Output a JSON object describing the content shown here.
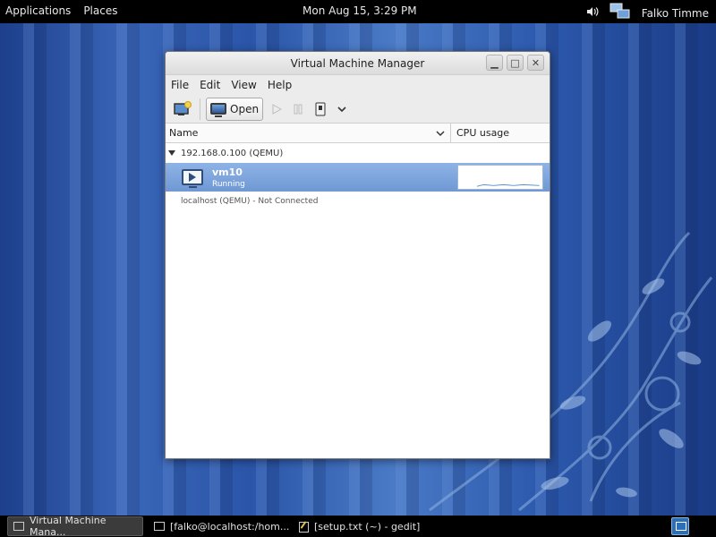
{
  "top_panel": {
    "applications": "Applications",
    "places": "Places",
    "clock": "Mon Aug 15,  3:29 PM",
    "user": "Falko Timme"
  },
  "window": {
    "title": "Virtual Machine Manager",
    "controls": {
      "minimize": "▁",
      "maximize": "□",
      "close": "✕"
    },
    "menu": [
      "File",
      "Edit",
      "View",
      "Help"
    ],
    "toolbar": {
      "open_label": "Open"
    },
    "columns": {
      "name": "Name",
      "cpu": "CPU usage"
    },
    "connections": [
      {
        "label": "192.168.0.100 (QEMU)",
        "vms": [
          {
            "name": "vm10",
            "status": "Running"
          }
        ]
      }
    ],
    "local_connection": "localhost (QEMU) - Not Connected"
  },
  "taskbar": {
    "items": [
      {
        "label": "Virtual Machine Mana...",
        "active": true
      },
      {
        "label": "[falko@localhost:/hom...",
        "active": false
      },
      {
        "label": "[setup.txt (~) - gedit]",
        "active": false
      }
    ]
  }
}
